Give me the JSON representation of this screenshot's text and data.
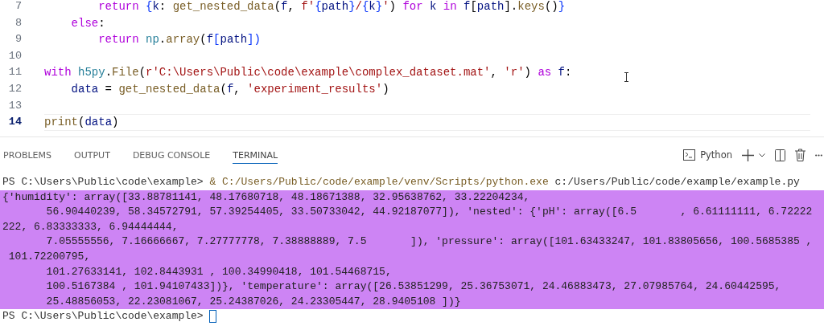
{
  "editor": {
    "lines": [
      {
        "number": "7",
        "current": false,
        "tokens": [
          {
            "text": "        return",
            "kind": "kw"
          },
          {
            "text": " {",
            "kind": "brace"
          },
          {
            "text": "k",
            "kind": "var"
          },
          {
            "text": ": ",
            "kind": "plain"
          },
          {
            "text": "get_nested_data",
            "kind": "fn"
          },
          {
            "text": "(",
            "kind": "plain"
          },
          {
            "text": "f",
            "kind": "var"
          },
          {
            "text": ", ",
            "kind": "plain"
          },
          {
            "text": "f'",
            "kind": "str"
          },
          {
            "text": "{",
            "kind": "brace"
          },
          {
            "text": "path",
            "kind": "var"
          },
          {
            "text": "}",
            "kind": "brace"
          },
          {
            "text": "/",
            "kind": "str"
          },
          {
            "text": "{",
            "kind": "brace"
          },
          {
            "text": "k",
            "kind": "var"
          },
          {
            "text": "}",
            "kind": "brace"
          },
          {
            "text": "'",
            "kind": "str"
          },
          {
            "text": ") ",
            "kind": "plain"
          },
          {
            "text": "for",
            "kind": "kw"
          },
          {
            "text": " k ",
            "kind": "var"
          },
          {
            "text": "in",
            "kind": "kw"
          },
          {
            "text": " f",
            "kind": "var"
          },
          {
            "text": "[",
            "kind": "plain"
          },
          {
            "text": "path",
            "kind": "var"
          },
          {
            "text": "].",
            "kind": "plain"
          },
          {
            "text": "keys",
            "kind": "fn"
          },
          {
            "text": "()",
            "kind": "plain"
          },
          {
            "text": "}",
            "kind": "brace"
          }
        ]
      },
      {
        "number": "8",
        "current": false,
        "tokens": [
          {
            "text": "    else",
            "kind": "kw"
          },
          {
            "text": ":",
            "kind": "plain"
          }
        ]
      },
      {
        "number": "9",
        "current": false,
        "tokens": [
          {
            "text": "        return",
            "kind": "kw"
          },
          {
            "text": " np",
            "kind": "cls"
          },
          {
            "text": ".",
            "kind": "plain"
          },
          {
            "text": "array",
            "kind": "fn"
          },
          {
            "text": "(",
            "kind": "plain"
          },
          {
            "text": "f",
            "kind": "var"
          },
          {
            "text": "[",
            "kind": "brace"
          },
          {
            "text": "path",
            "kind": "var"
          },
          {
            "text": "])",
            "kind": "brace"
          }
        ]
      },
      {
        "number": "10",
        "current": false
      },
      {
        "number": "11",
        "current": false,
        "tokens": [
          {
            "text": "with",
            "kind": "kw"
          },
          {
            "text": " h5py",
            "kind": "cls"
          },
          {
            "text": ".",
            "kind": "plain"
          },
          {
            "text": "File",
            "kind": "fn"
          },
          {
            "text": "(",
            "kind": "plain"
          },
          {
            "text": "r'C:\\Users\\Public\\code\\example\\complex_dataset.mat'",
            "kind": "str"
          },
          {
            "text": ", ",
            "kind": "plain"
          },
          {
            "text": "'r'",
            "kind": "str"
          },
          {
            "text": ") ",
            "kind": "plain"
          },
          {
            "text": "as",
            "kind": "kw"
          },
          {
            "text": " f",
            "kind": "var"
          },
          {
            "text": ":",
            "kind": "plain"
          }
        ]
      },
      {
        "number": "12",
        "current": false,
        "tokens": [
          {
            "text": "    data",
            "kind": "var"
          },
          {
            "text": " = ",
            "kind": "plain"
          },
          {
            "text": "get_nested_data",
            "kind": "fn"
          },
          {
            "text": "(",
            "kind": "plain"
          },
          {
            "text": "f",
            "kind": "var"
          },
          {
            "text": ", ",
            "kind": "plain"
          },
          {
            "text": "'experiment_results'",
            "kind": "str"
          },
          {
            "text": ")",
            "kind": "plain"
          }
        ]
      },
      {
        "number": "13",
        "current": false
      },
      {
        "number": "14",
        "current": true,
        "tokens": [
          {
            "text": "print",
            "kind": "fn"
          },
          {
            "text": "(",
            "kind": "plain"
          },
          {
            "text": "data",
            "kind": "var"
          },
          {
            "text": ")",
            "kind": "plain"
          }
        ]
      }
    ]
  },
  "panel": {
    "tabs": [
      {
        "label": "PROBLEMS",
        "selected": false
      },
      {
        "label": "OUTPUT",
        "selected": false
      },
      {
        "label": "DEBUG CONSOLE",
        "selected": false
      },
      {
        "label": "TERMINAL",
        "selected": true
      }
    ],
    "profile": "Python",
    "terminal": [
      {
        "kind": "command",
        "prompt": "PS C:\\Users\\Public\\code\\example> ",
        "command": "& C:/Users/Public/code/example/venv/Scripts/python.exe",
        "args": " c:/Users/Public/code/example/example.py"
      },
      {
        "kind": "output",
        "highlighted": true,
        "text": "{'humidity': array([33.88781141, 48.17680718, 48.18671388, 32.95638762, 33.22204234,"
      },
      {
        "kind": "output",
        "highlighted": true,
        "text": "       56.90440239, 58.34572791, 57.39254405, 33.50733042, 44.92187077]), 'nested': {'pH': array([6.5       , 6.61111111, 6.72222"
      },
      {
        "kind": "output",
        "highlighted": true,
        "text": "222, 6.83333333, 6.94444444,"
      },
      {
        "kind": "output",
        "highlighted": true,
        "text": "       7.05555556, 7.16666667, 7.27777778, 7.38888889, 7.5       ]), 'pressure': array([101.63433247, 101.83805656, 100.5685385 ,"
      },
      {
        "kind": "output",
        "highlighted": true,
        "text": " 101.72200795,"
      },
      {
        "kind": "output",
        "highlighted": true,
        "text": "       101.27633141, 102.8443931 , 100.34990418, 101.54468715,"
      },
      {
        "kind": "output",
        "highlighted": true,
        "text": "       100.5167384 , 101.94107433])}, 'temperature': array([26.53851299, 25.36753071, 24.46883473, 27.07985764, 24.60442595,"
      },
      {
        "kind": "output",
        "highlighted": true,
        "text": "       25.48856053, 22.23081067, 25.24387026, 24.23305447, 28.9405108 ])}"
      },
      {
        "kind": "prompt",
        "prompt": "PS C:\\Users\\Public\\code\\example> "
      }
    ]
  }
}
